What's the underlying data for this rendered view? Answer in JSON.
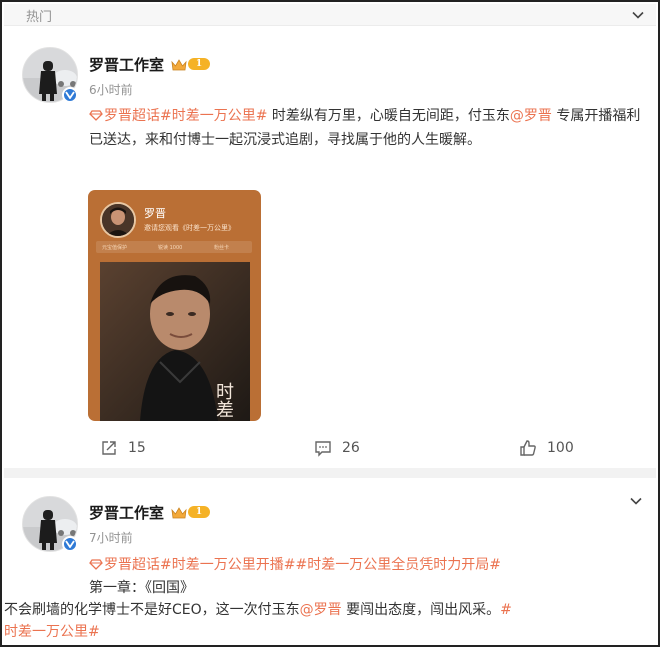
{
  "feed": {
    "hot_label": "热门"
  },
  "posts": [
    {
      "author": "罗晋工作室",
      "level": "1",
      "time": "6小时前",
      "text": {
        "tag1": "罗晋超话",
        "tag2": "#时差一万公里#",
        "body1": " 时差纵有万里，心暖自无间距，付玉东",
        "mention": "@罗晋",
        "body2": " 专属开播福利已送达，来和付博士一起沉浸式追剧，寻找属于他的人生暖解。"
      },
      "card": {
        "name": "罗晋",
        "subtitle": "邀请您观看《时差一万公里》",
        "stats": [
          "元宝值保护",
          "锐读 1000",
          "粉丝卡"
        ],
        "poster_text": "时差"
      },
      "actions": {
        "repost_count": "15",
        "comment_count": "26",
        "like_count": "100"
      }
    },
    {
      "author": "罗晋工作室",
      "level": "1",
      "time": "7小时前",
      "text": {
        "tag1": "罗晋超话",
        "tag2": "#时差一万公里开播#",
        "tag3": "#时差一万公里全员凭时力开局#",
        "line2": "第一章：《回国》",
        "body1": "不会刷墙的化学博士不是好CEO，这一次付玉东",
        "mention": "@罗晋",
        "body2": " 要闯出态度，闯出风采。",
        "tag4a": "#",
        "tag4b": "时差一万公里#"
      }
    }
  ],
  "colors": {
    "accent": "#eb7350",
    "card_bg": "#ba6f35",
    "verified": "#2f7ad6",
    "level_badge": "#f5b226"
  },
  "icons": {
    "collapse": "chevron-down-icon",
    "supertopic": "diamond-icon",
    "repost": "repost-icon",
    "comment": "comment-icon",
    "like": "thumbs-up-icon",
    "verified": "verified-icon",
    "vip": "crown-icon"
  }
}
